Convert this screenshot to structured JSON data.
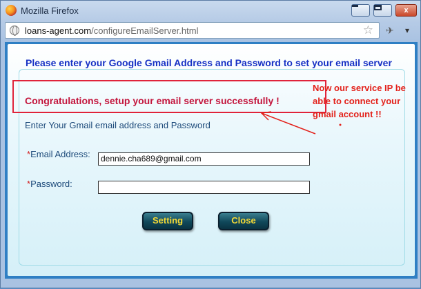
{
  "window": {
    "title": "Mozilla Firefox",
    "buttons": {
      "minimize": "",
      "maximize": "",
      "close": "x"
    }
  },
  "addressbar": {
    "url_host": "loans-agent.com",
    "url_path": "/configureEmailServer.html"
  },
  "page": {
    "heading": "Please enter your Google Gmail Address and Password to set your email server",
    "success_message": "Congratulations, setup your email server successfully !",
    "subtitle": "Enter Your Gmail email address and Password",
    "email_label": "Email Address:",
    "email_value": "dennie.cha689@gmail.com",
    "password_label": "Password:",
    "password_value": "",
    "required_mark": "*",
    "setting_button": "Setting",
    "close_button": "Close"
  },
  "annotation": {
    "text": "Now our service IP be\nable to connect your\ngmail account !!",
    "color": "#e3211a"
  },
  "colors": {
    "heading": "#1630c4",
    "success": "#c3153c",
    "button_text": "#f5d935",
    "button_bg": "#10485a"
  }
}
